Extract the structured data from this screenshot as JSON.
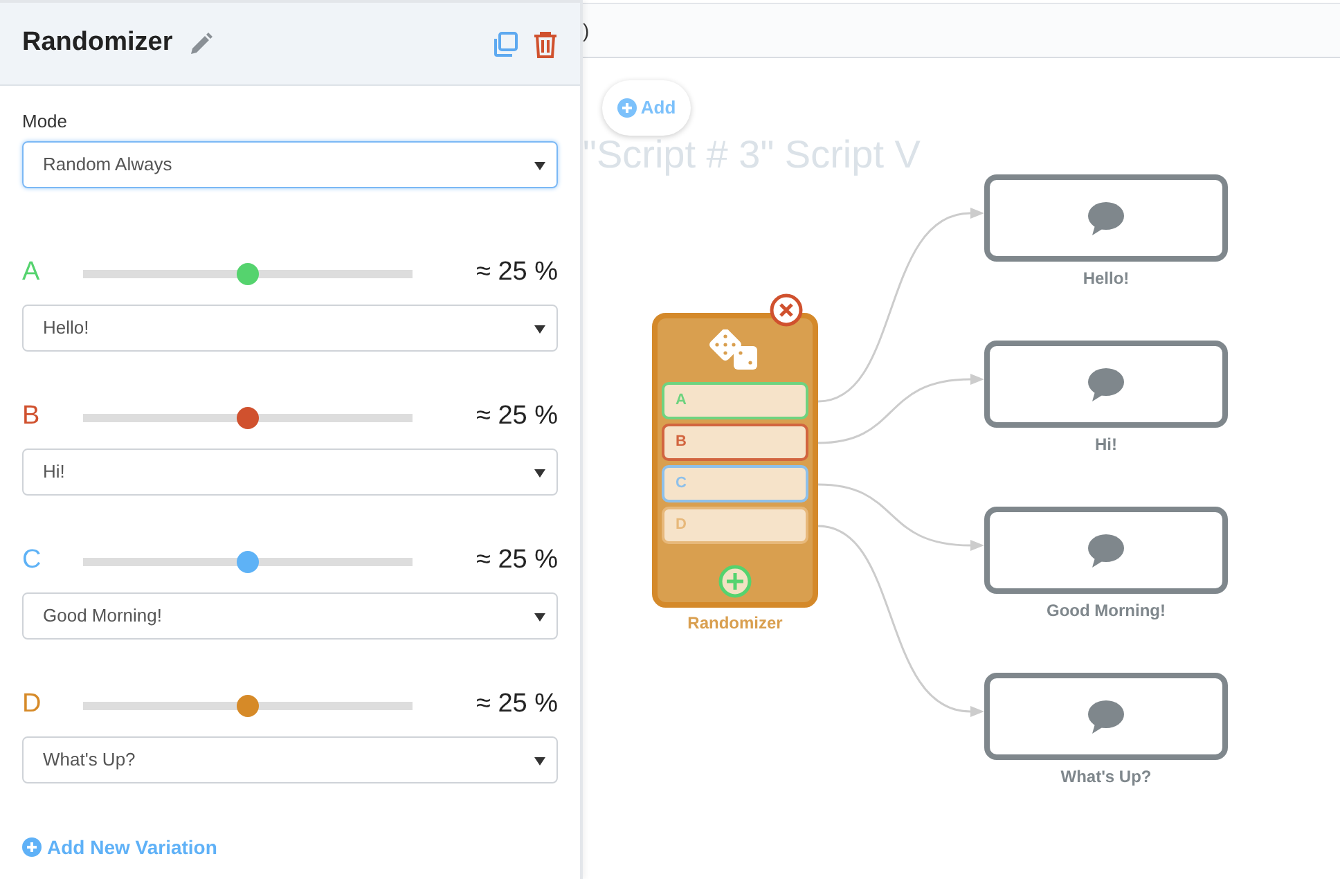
{
  "panel": {
    "title": "Randomizer",
    "mode_label": "Mode",
    "mode_value": "Random Always",
    "variations": [
      {
        "letter": "A",
        "color": "#55d36e",
        "level": 0.5,
        "percent": "≈ 25 %",
        "message": "Hello!"
      },
      {
        "letter": "B",
        "color": "#d0512e",
        "level": 0.5,
        "percent": "≈ 25 %",
        "message": "Hi!"
      },
      {
        "letter": "C",
        "color": "#5eb2f6",
        "level": 0.5,
        "percent": "≈ 25 %",
        "message": "Good Morning!"
      },
      {
        "letter": "D",
        "color": "#d68a28",
        "level": 0.5,
        "percent": "≈ 25 %",
        "message": "What's Up?"
      }
    ],
    "add_variation": "Add New Variation"
  },
  "canvas": {
    "top_bar_text": ")",
    "add_button": "Add",
    "title": "\"Script # 3\" Script V",
    "randomizer_node": {
      "label": "Randomizer",
      "outputs": [
        {
          "letter": "A",
          "color": "#6fd37f"
        },
        {
          "letter": "B",
          "color": "#d2653f"
        },
        {
          "letter": "C",
          "color": "#8ec0ea"
        },
        {
          "letter": "D",
          "color": "#e7b87a"
        }
      ]
    },
    "message_nodes": [
      {
        "label": "Hello!"
      },
      {
        "label": "Hi!"
      },
      {
        "label": "Good Morning!"
      },
      {
        "label": "What's Up?"
      }
    ]
  }
}
